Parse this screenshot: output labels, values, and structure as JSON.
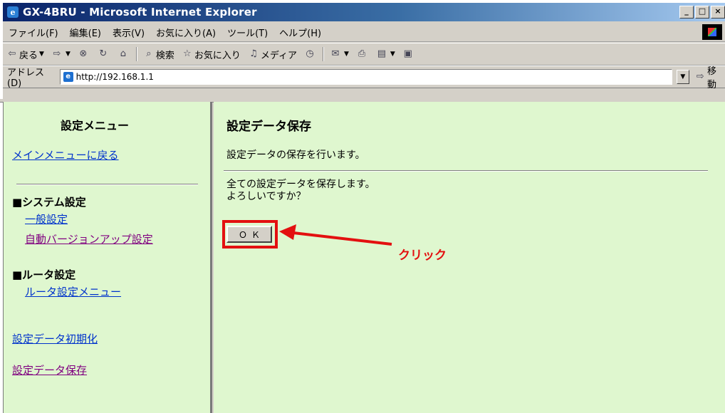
{
  "window": {
    "title": "GX-4BRU - Microsoft Internet Explorer",
    "icon": "ie-page-icon"
  },
  "menubar": {
    "items": [
      "ファイル(F)",
      "編集(E)",
      "表示(V)",
      "お気に入り(A)",
      "ツール(T)",
      "ヘルプ(H)"
    ]
  },
  "toolbar": {
    "back_label": "戻る",
    "search_label": "検索",
    "favorites_label": "お気に入り",
    "media_label": "メディア"
  },
  "addressbar": {
    "label": "アドレス(D)",
    "url": "http://192.168.1.1",
    "go_label": "移動"
  },
  "sidebar": {
    "title": "設定メニュー",
    "back_link": "メインメニューに戻る",
    "system_section": "■システム設定",
    "system_links": [
      "一般設定",
      "自動バージョンアップ設定"
    ],
    "router_section": "■ルータ設定",
    "router_links": [
      "ルータ設定メニュー"
    ],
    "init_link": "設定データ初期化",
    "save_link": "設定データ保存"
  },
  "main": {
    "title": "設定データ保存",
    "description": "設定データの保存を行います。",
    "message_line1": "全ての設定データを保存します。",
    "message_line2": "よろしいですか？",
    "ok_label": "ＯＫ"
  },
  "annotation": {
    "label": "クリック",
    "color": "#e31010"
  }
}
